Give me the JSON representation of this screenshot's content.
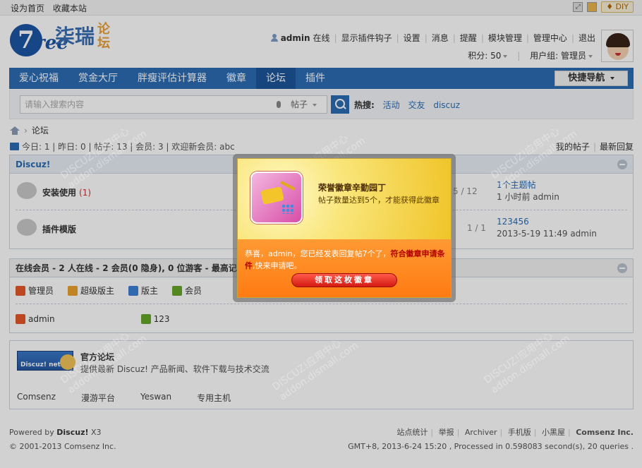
{
  "topbar": {
    "set_home": "设为首页",
    "bookmark": "收藏本站",
    "diy_label": "♦ DIY"
  },
  "logo": {
    "seven": "7",
    "ree": "ree",
    "cn_name": "柒瑞",
    "forum_tag": "论坛"
  },
  "user": {
    "name": "admin",
    "status": "在线",
    "menu": [
      "显示插件钩子",
      "设置",
      "消息",
      "提醒",
      "模块管理",
      "管理中心",
      "退出"
    ],
    "points_label": "积分: 50",
    "group_label": "用户组: 管理员"
  },
  "nav": {
    "items": [
      "爱心祝福",
      "赏金大厅",
      "胖瘦评估计算器",
      "徽章",
      "论坛",
      "插件"
    ],
    "active_index": 4,
    "quick_nav": "快捷导航"
  },
  "search": {
    "placeholder": "请输入搜索内容",
    "type": "帖子",
    "hot_label": "热搜:",
    "hot_terms": [
      "活动",
      "交友",
      "discuz"
    ]
  },
  "breadcrumb": {
    "current": "论坛"
  },
  "stats": {
    "text": "今日: 1 | 昨日: 0 | 帖子: 13 | 会员: 3 | 欢迎新会员: abc"
  },
  "right_links": [
    "我的帖子",
    "最新回复"
  ],
  "forum_section": {
    "title": "Discuz!",
    "forums": [
      {
        "name": "安装使用",
        "new_count": "(1)",
        "counts": "5 / 12",
        "last_title": "1个主题帖",
        "last_meta": "1 小时前 admin"
      },
      {
        "name": "插件模版",
        "new_count": "",
        "counts": "1 / 1",
        "last_title": "123456",
        "last_meta": "2013-5-19 11:49 admin"
      }
    ]
  },
  "online": {
    "title": "在线会员 - 2 人在线 - 2 会员(0 隐身), 0 位游客 - 最高记录",
    "roles": [
      "管理员",
      "超级版主",
      "版主",
      "会员"
    ],
    "members": [
      "admin",
      "123"
    ]
  },
  "links_box": {
    "logo_text": "Discuz! net",
    "official_title": "官方论坛",
    "official_desc": "提供最新 Discuz! 产品新闻、软件下载与技术交流",
    "partners": [
      "Comsenz",
      "漫游平台",
      "Yeswan",
      "专用主机"
    ]
  },
  "footer": {
    "powered_prefix": "Powered by ",
    "powered_brand": "Discuz!",
    "version": " X3",
    "copyright": "© 2001-2013 Comsenz Inc.",
    "links": [
      "站点统计",
      "举报",
      "Archiver",
      "手机版",
      "小黑屋"
    ],
    "company": "Comsenz Inc.",
    "runtime": "GMT+8, 2013-6-24 15:20 , Processed in 0.598083 second(s), 20 queries ."
  },
  "popup": {
    "badge_title": "荣誉徽章辛勤园丁",
    "badge_desc": "帖子数量达到5个，才能获得此徽章",
    "msg_prefix": "恭喜，admin，您已经发表回复帖7个了，",
    "msg_highlight": "符合徽章申请条件",
    "msg_suffix": ",快来申请吧。",
    "claim_button": "领取这枚徽章"
  },
  "watermark": {
    "line1": "DISCUZ!应用中心",
    "line2": "addon.dismall.com"
  }
}
